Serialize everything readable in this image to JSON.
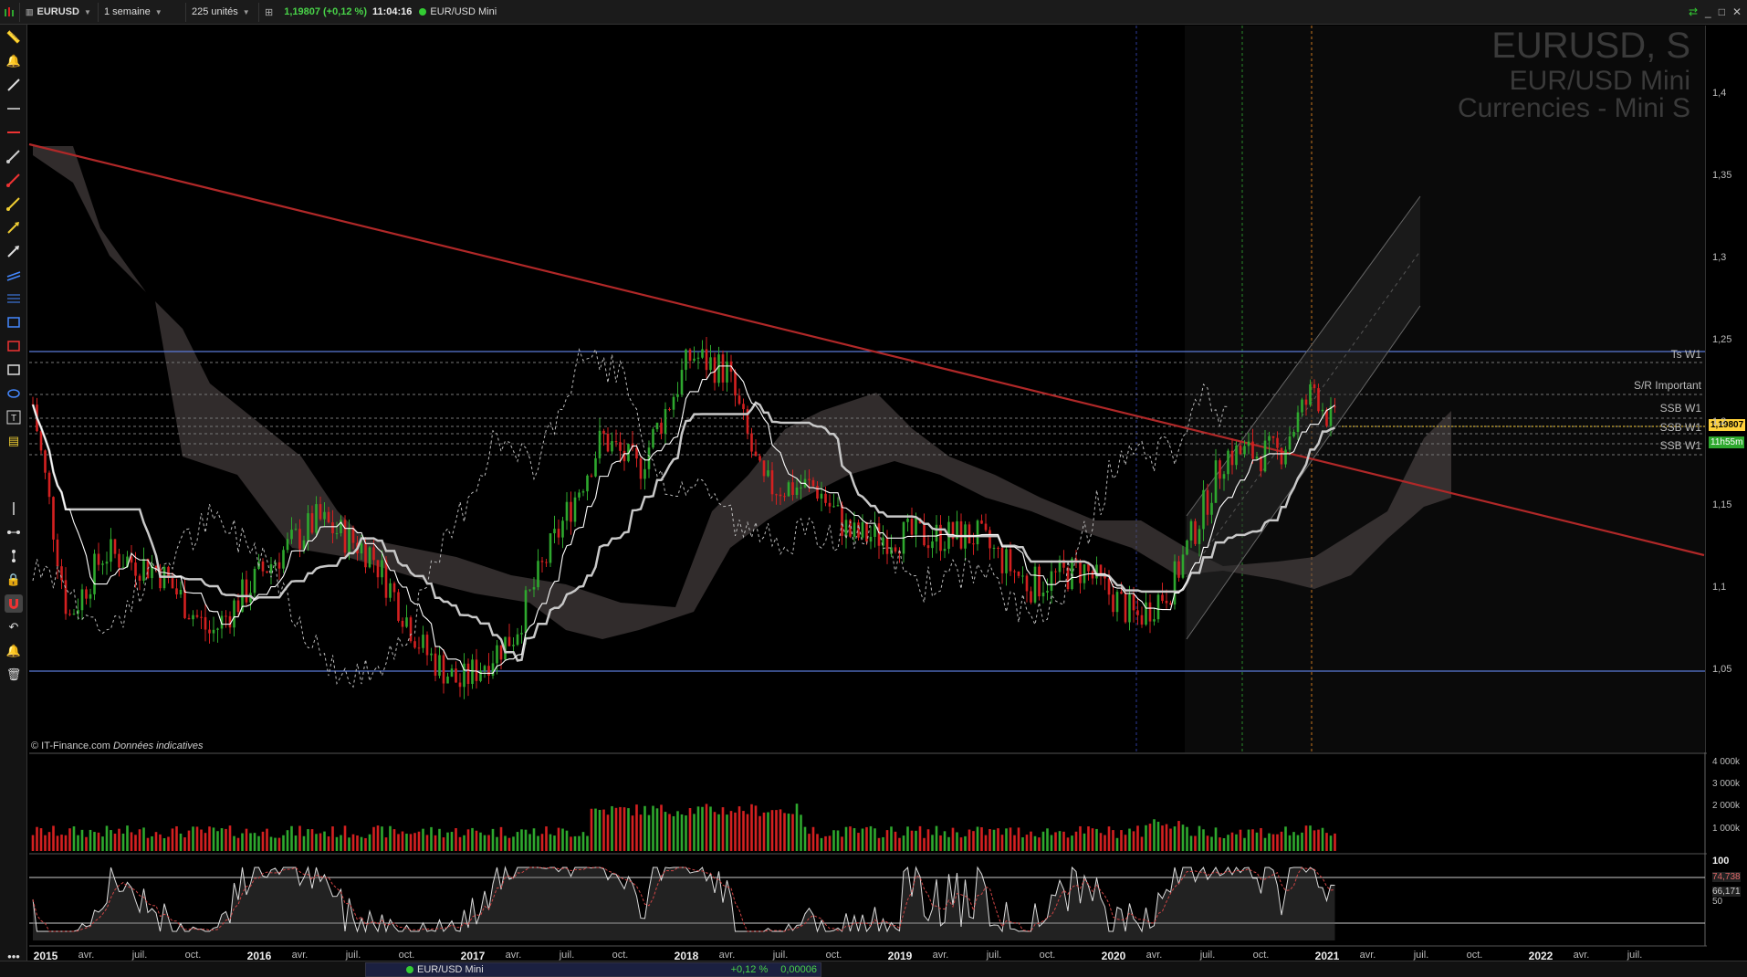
{
  "toolbar": {
    "symbol": "EURUSD",
    "period": "1 semaine",
    "units": "225 unités",
    "price": "1,19807",
    "change": "(+0,12 %)",
    "time": "11:04:16",
    "instrument": "EUR/USD Mini"
  },
  "overlay": {
    "title": "EURUSD, S",
    "subtitle": "EUR/USD Mini",
    "category": "Currencies - Mini S"
  },
  "copyright": {
    "source": "© IT-Finance.com",
    "note": "Données indicatives"
  },
  "levels": [
    {
      "label": "Ts W1",
      "price": 1.245,
      "color": "#5a7ad8",
      "style": "solid"
    },
    {
      "label": "S/R Important",
      "price": 1.2135
    },
    {
      "label": "SSB W1",
      "price": 1.2025
    },
    {
      "label": "SSB W1",
      "price": 1.1945
    },
    {
      "label": "SSB W1",
      "price": 1.1835
    },
    {
      "label": "",
      "price": 1.0485,
      "color": "#5a7ad8",
      "style": "solid"
    }
  ],
  "price_tags": {
    "last": "1,19807",
    "countdown": "11h55m"
  },
  "axes": {
    "price_ticks": [
      "1,4",
      "1,35",
      "1,3",
      "1,25",
      "1,2",
      "1,15",
      "1,1",
      "1,05"
    ],
    "price_values": [
      1.4,
      1.35,
      1.3,
      1.25,
      1.2,
      1.15,
      1.1,
      1.05
    ],
    "volume_ticks": [
      "4 000k",
      "3 000k",
      "2 000k",
      "1 000k"
    ],
    "osc_ticks": [
      "100",
      "74,738",
      "66,171",
      "50"
    ],
    "time_labels": [
      {
        "t": "2015",
        "year": true
      },
      {
        "t": "avr."
      },
      {
        "t": "juil."
      },
      {
        "t": "oct."
      },
      {
        "t": "2016",
        "year": true
      },
      {
        "t": "avr."
      },
      {
        "t": "juil."
      },
      {
        "t": "oct."
      },
      {
        "t": "2017",
        "year": true
      },
      {
        "t": "avr."
      },
      {
        "t": "juil."
      },
      {
        "t": "oct."
      },
      {
        "t": "2018",
        "year": true
      },
      {
        "t": "avr."
      },
      {
        "t": "juil."
      },
      {
        "t": "oct."
      },
      {
        "t": "2019",
        "year": true
      },
      {
        "t": "avr."
      },
      {
        "t": "juil."
      },
      {
        "t": "oct."
      },
      {
        "t": "2020",
        "year": true
      },
      {
        "t": "avr."
      },
      {
        "t": "juil."
      },
      {
        "t": "oct."
      },
      {
        "t": "2021",
        "year": true
      },
      {
        "t": "avr."
      },
      {
        "t": "juil."
      },
      {
        "t": "oct."
      },
      {
        "t": "2022",
        "year": true
      },
      {
        "t": "avr."
      },
      {
        "t": "juil."
      }
    ]
  },
  "statusbar": {
    "instrument": "EUR/USD Mini",
    "change": "+0,12 %",
    "value": "0,00006"
  },
  "colors": {
    "up": "#2ea82e",
    "down": "#d42020",
    "trendline": "#b02828",
    "level": "#5a7ad8",
    "cloud": "#5a5050",
    "kijun": "#c8c8c8",
    "tenkan": "#ffffff"
  },
  "chart_data": {
    "type": "candlestick",
    "x_range": [
      "2015",
      "2022"
    ],
    "y_range": [
      1.0,
      1.42
    ],
    "price_path": [
      [
        "2015-01",
        1.21
      ],
      [
        "2015-03",
        1.08
      ],
      [
        "2015-05",
        1.12
      ],
      [
        "2015-08",
        1.11
      ],
      [
        "2015-11",
        1.07
      ],
      [
        "2016-02",
        1.11
      ],
      [
        "2016-05",
        1.14
      ],
      [
        "2016-08",
        1.12
      ],
      [
        "2016-11",
        1.06
      ],
      [
        "2017-01",
        1.04
      ],
      [
        "2017-04",
        1.07
      ],
      [
        "2017-06",
        1.12
      ],
      [
        "2017-09",
        1.19
      ],
      [
        "2017-11",
        1.17
      ],
      [
        "2018-02",
        1.24
      ],
      [
        "2018-04",
        1.23
      ],
      [
        "2018-06",
        1.16
      ],
      [
        "2018-09",
        1.16
      ],
      [
        "2018-11",
        1.13
      ],
      [
        "2019-03",
        1.13
      ],
      [
        "2019-06",
        1.13
      ],
      [
        "2019-09",
        1.1
      ],
      [
        "2019-12",
        1.11
      ],
      [
        "2020-03",
        1.08
      ],
      [
        "2020-05",
        1.1
      ],
      [
        "2020-08",
        1.18
      ],
      [
        "2020-11",
        1.18
      ],
      [
        "2021-01",
        1.22
      ],
      [
        "2021-02",
        1.198
      ]
    ]
  }
}
